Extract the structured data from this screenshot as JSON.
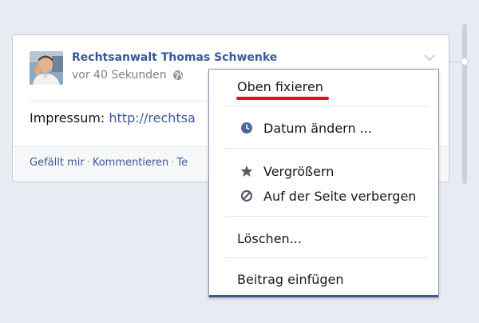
{
  "post": {
    "author_name": "Rechtsanwalt Thomas Schwenke",
    "timestamp": "vor 40 Sekunden",
    "text_prefix": "Impressum: ",
    "link_text": "http://rechtsa",
    "actions": {
      "like": "Gefällt mir",
      "comment": "Kommentieren",
      "share_partial": "Te"
    }
  },
  "dropdown": {
    "items": [
      {
        "label": "Oben fixieren",
        "icon": "none"
      },
      {
        "label": "Datum ändern ...",
        "icon": "clock-icon"
      },
      {
        "label": "Vergrößern",
        "icon": "star-icon"
      },
      {
        "label": "Auf der Seite verbergen",
        "icon": "hide-icon"
      },
      {
        "label": "Löschen...",
        "icon": "none"
      },
      {
        "label": "Beitrag einfügen",
        "icon": "none"
      }
    ]
  },
  "colors": {
    "link_blue": "#3b5998",
    "highlight_red": "#d8151a",
    "page_bg": "#e9ebf2"
  }
}
